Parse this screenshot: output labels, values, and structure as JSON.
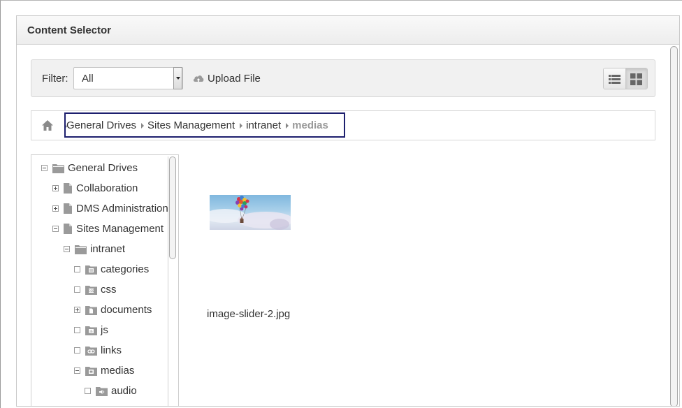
{
  "dialog": {
    "title": "Content Selector"
  },
  "toolbar": {
    "filter_label": "Filter:",
    "filter_value": "All",
    "upload_label": "Upload File",
    "upload_icon": "cloud-upload-icon",
    "list_view_icon": "list-view-icon",
    "grid_view_icon": "grid-view-icon",
    "active_view": "grid"
  },
  "breadcrumb": {
    "home_icon": "home-icon",
    "items": [
      "General Drives",
      "Sites Management",
      "intranet",
      "medias"
    ],
    "current": "medias"
  },
  "tree": {
    "nodes": [
      {
        "label": "General Drives",
        "toggle": "minus",
        "icon": "folder-open-icon"
      },
      {
        "label": "Collaboration",
        "toggle": "plus",
        "icon": "document-icon"
      },
      {
        "label": "DMS Administration",
        "toggle": "plus",
        "icon": "document-icon"
      },
      {
        "label": "Sites Management",
        "toggle": "minus",
        "icon": "document-icon"
      },
      {
        "label": "intranet",
        "toggle": "minus",
        "icon": "folder-open-icon"
      },
      {
        "label": "categories",
        "toggle": "none",
        "icon": "categories-folder-icon"
      },
      {
        "label": "css",
        "toggle": "none",
        "icon": "css-folder-icon"
      },
      {
        "label": "documents",
        "toggle": "plus",
        "icon": "documents-folder-icon"
      },
      {
        "label": "js",
        "toggle": "none",
        "icon": "js-folder-icon"
      },
      {
        "label": "links",
        "toggle": "none",
        "icon": "links-folder-icon"
      },
      {
        "label": "medias",
        "toggle": "minus",
        "icon": "medias-folder-icon"
      },
      {
        "label": "audio",
        "toggle": "none",
        "icon": "audio-folder-icon"
      }
    ]
  },
  "files": [
    {
      "name": "image-slider-2.jpg",
      "thumbnail": "balloon-thumbnail"
    }
  ],
  "colors": {
    "header_bg": "#efefef",
    "breadcrumb_focus": "#1d1f6e",
    "current_crumb": "#999999"
  }
}
